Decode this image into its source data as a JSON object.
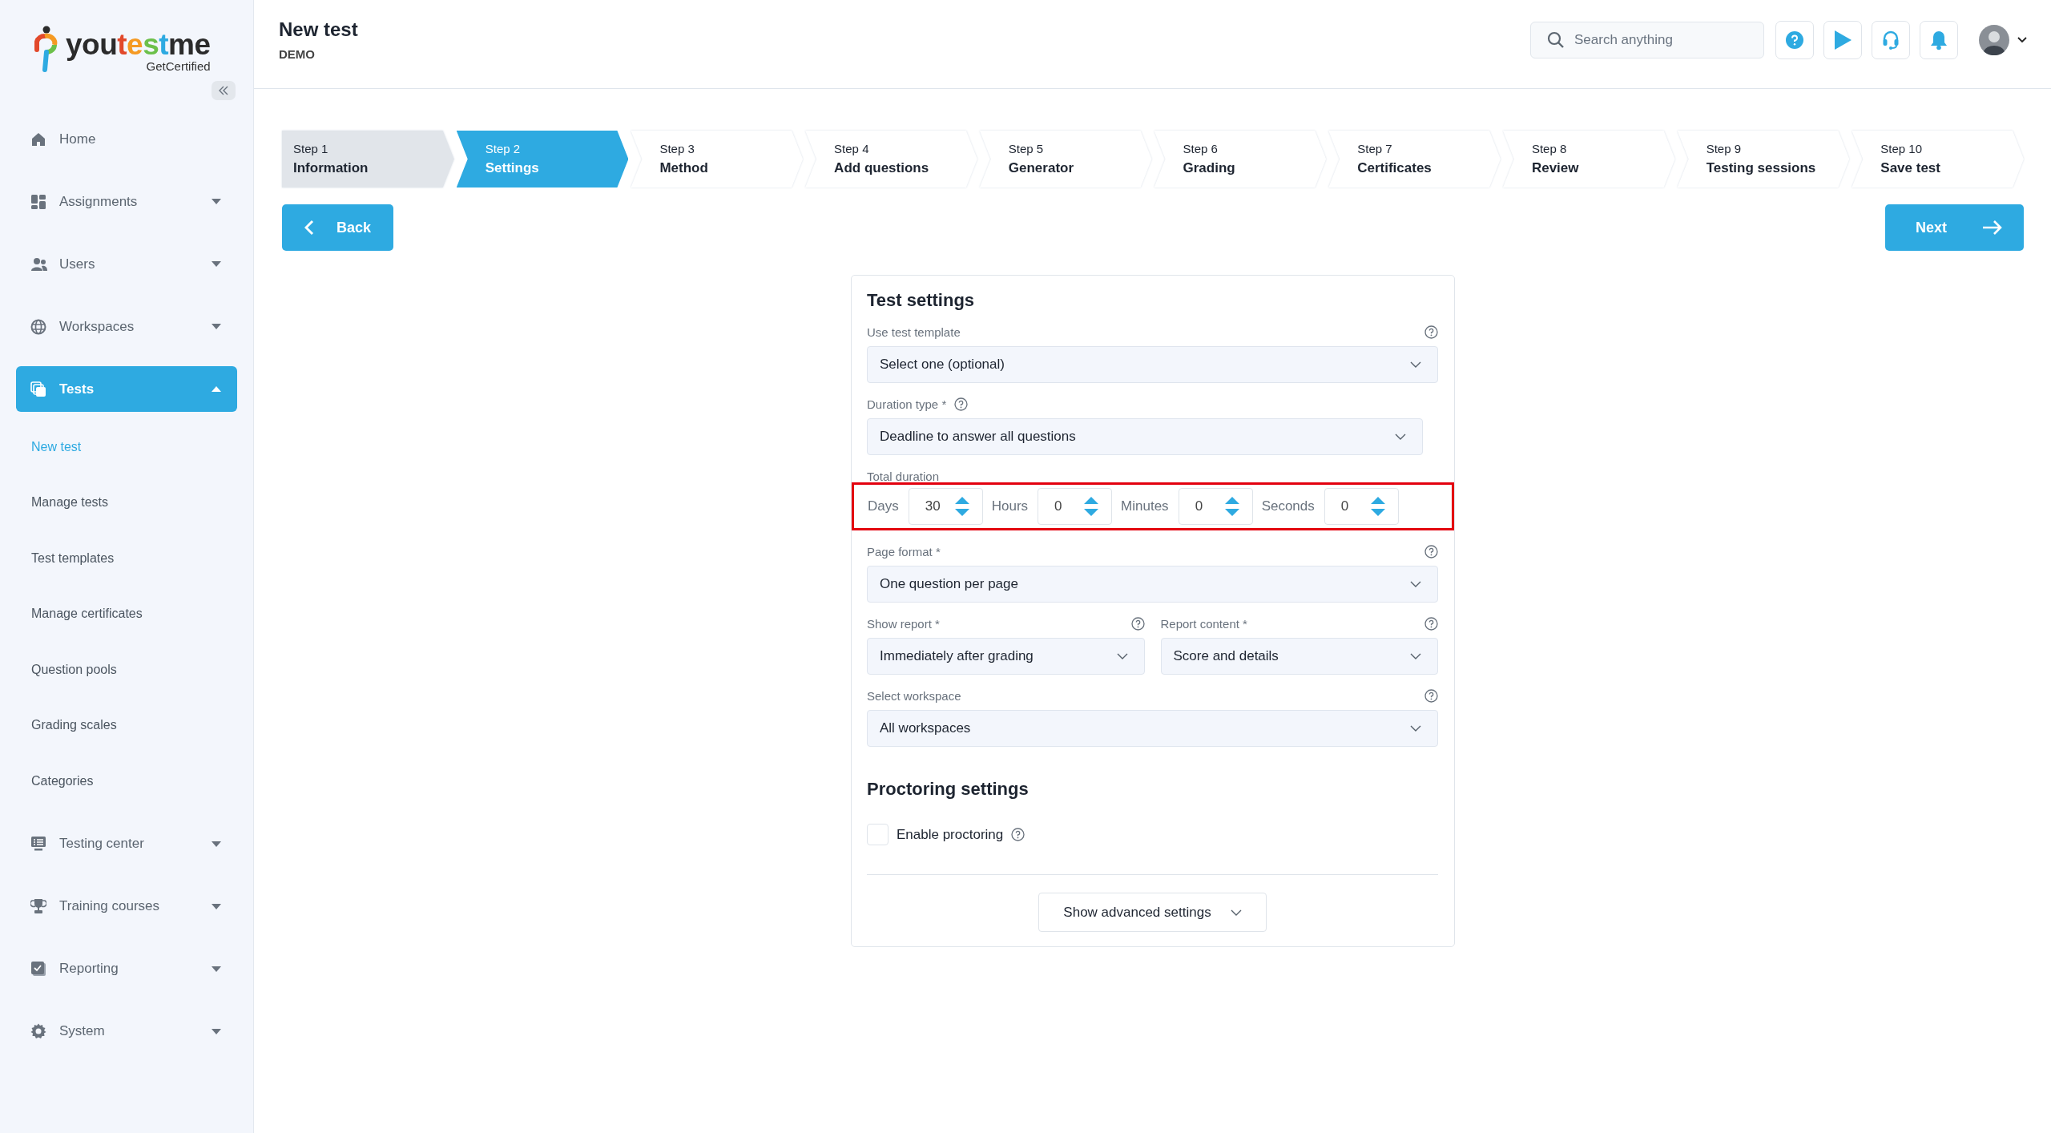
{
  "sidebar": {
    "logo": {
      "parts": [
        {
          "text": "you",
          "color": "#2b2b2b"
        },
        {
          "text": "t",
          "color": "#e2492b"
        },
        {
          "text": "e",
          "color": "#f59a23"
        },
        {
          "text": "s",
          "color": "#6cc04a"
        },
        {
          "text": "t",
          "color": "#2eaae1"
        },
        {
          "text": "me",
          "color": "#2b2b2b"
        }
      ],
      "tagline": "GetCertified"
    },
    "items": [
      {
        "label": "Home",
        "selected": false
      },
      {
        "label": "Assignments",
        "selected": false,
        "expanded": false
      },
      {
        "label": "Users",
        "selected": false,
        "expanded": false
      },
      {
        "label": "Workspaces",
        "selected": false,
        "expanded": false
      },
      {
        "label": "Tests",
        "selected": true,
        "expanded": true,
        "children": [
          {
            "label": "New test",
            "selected": true
          },
          {
            "label": "Manage tests",
            "selected": false
          },
          {
            "label": "Test templates",
            "selected": false
          },
          {
            "label": "Manage certificates",
            "selected": false
          },
          {
            "label": "Question pools",
            "selected": false
          },
          {
            "label": "Grading scales",
            "selected": false
          },
          {
            "label": "Categories",
            "selected": false
          }
        ]
      },
      {
        "label": "Testing center",
        "selected": false,
        "expanded": false
      },
      {
        "label": "Training courses",
        "selected": false,
        "expanded": false
      },
      {
        "label": "Reporting",
        "selected": false,
        "expanded": false
      },
      {
        "label": "System",
        "selected": false,
        "expanded": false
      }
    ]
  },
  "header": {
    "title": "New test",
    "subtitle": "DEMO",
    "search": {
      "placeholder": "Search anything"
    }
  },
  "steps": [
    {
      "number": "Step 1",
      "name": "Information",
      "selected": false,
      "completed": true
    },
    {
      "number": "Step 2",
      "name": "Settings",
      "selected": true,
      "completed": false
    },
    {
      "number": "Step 3",
      "name": "Method",
      "selected": false,
      "completed": false
    },
    {
      "number": "Step 4",
      "name": "Add questions",
      "selected": false,
      "completed": false
    },
    {
      "number": "Step 5",
      "name": "Generator",
      "selected": false,
      "completed": false
    },
    {
      "number": "Step 6",
      "name": "Grading",
      "selected": false,
      "completed": false
    },
    {
      "number": "Step 7",
      "name": "Certificates",
      "selected": false,
      "completed": false
    },
    {
      "number": "Step 8",
      "name": "Review",
      "selected": false,
      "completed": false
    },
    {
      "number": "Step 9",
      "name": "Testing sessions",
      "selected": false,
      "completed": false
    },
    {
      "number": "Step 10",
      "name": "Save test",
      "selected": false,
      "completed": false
    }
  ],
  "buttons": {
    "back": "Back",
    "next": "Next"
  },
  "form": {
    "title": "Test settings",
    "fields": [
      {
        "kind": "select",
        "label": "Use test template",
        "help": true,
        "help_inline": false,
        "value": "Select one (optional)"
      },
      {
        "kind": "select",
        "label": "Duration type *",
        "help": true,
        "help_inline": true,
        "value": "Deadline to answer all questions"
      },
      {
        "kind": "duration",
        "label": "Total duration",
        "highlighted": true,
        "units": [
          {
            "label": "Days",
            "value": "30"
          },
          {
            "label": "Hours",
            "value": "0"
          },
          {
            "label": "Minutes",
            "value": "0"
          },
          {
            "label": "Seconds",
            "value": "0"
          }
        ]
      },
      {
        "kind": "select",
        "label": "Page format *",
        "help": true,
        "help_inline": false,
        "value": "One question per page"
      },
      {
        "kind": "pair",
        "items": [
          {
            "label": "Show report *",
            "help": true,
            "value": "Immediately after grading"
          },
          {
            "label": "Report content *",
            "help": true,
            "value": "Score and details"
          }
        ]
      },
      {
        "kind": "select",
        "label": "Select workspace",
        "help": true,
        "help_inline": false,
        "value": "All workspaces"
      }
    ],
    "proctoring": {
      "title": "Proctoring settings",
      "checkbox": {
        "label": "Enable proctoring",
        "checked": false,
        "help": true
      }
    },
    "advanced_button": "Show advanced settings"
  }
}
